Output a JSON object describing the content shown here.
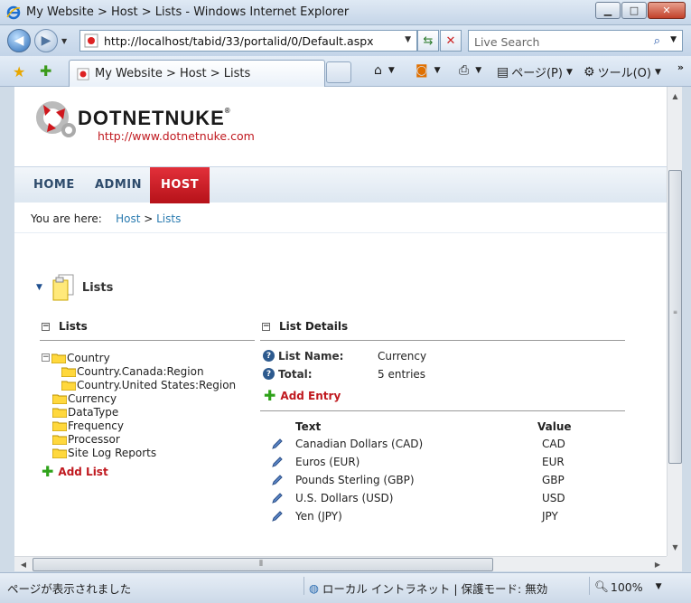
{
  "window": {
    "title": "My Website > Host > Lists - Windows Internet Explorer",
    "minimize": "▁",
    "maximize": "□",
    "close": "✕"
  },
  "address_bar": {
    "url": "http://localhost/tabid/33/portalid/0/Default.aspx",
    "search_placeholder": "Live Search"
  },
  "tab": {
    "label": "My Website > Host > Lists"
  },
  "command_bar": {
    "page_label": "ページ(P)",
    "tools_label": "ツール(O)",
    "more": "»"
  },
  "site": {
    "logo_text": "DOTNETNUKE",
    "logo_reg": "®",
    "logo_url": "http://www.dotnetnuke.com",
    "menu": [
      "HOME",
      "ADMIN",
      "HOST"
    ],
    "active_menu": "HOST",
    "breadcrumb_prefix": "You are here:",
    "breadcrumb_host": "Host",
    "breadcrumb_sep": ">",
    "breadcrumb_lists": "Lists"
  },
  "module": {
    "title": "Lists",
    "lists_section": "Lists",
    "details_section": "List Details",
    "tree": [
      {
        "label": "Country",
        "level": 0,
        "expand": "−"
      },
      {
        "label": "Country.Canada:Region",
        "level": 1
      },
      {
        "label": "Country.United States:Region",
        "level": 1
      },
      {
        "label": "Currency",
        "level": 0
      },
      {
        "label": "DataType",
        "level": 0
      },
      {
        "label": "Frequency",
        "level": 0
      },
      {
        "label": "Processor",
        "level": 0
      },
      {
        "label": "Site Log Reports",
        "level": 0
      }
    ],
    "add_list": "Add List",
    "list_name_label": "List Name:",
    "list_name_value": "Currency",
    "total_label": "Total:",
    "total_value": "5 entries",
    "add_entry": "Add Entry",
    "col_text": "Text",
    "col_value": "Value",
    "entries": [
      {
        "text": "Canadian Dollars (CAD)",
        "value": "CAD"
      },
      {
        "text": "Euros (EUR)",
        "value": "EUR"
      },
      {
        "text": "Pounds Sterling (GBP)",
        "value": "GBP"
      },
      {
        "text": "U.S. Dollars (USD)",
        "value": "USD"
      },
      {
        "text": "Yen (JPY)",
        "value": "JPY"
      }
    ]
  },
  "status_bar": {
    "status": "ページが表示されました",
    "zone": "ローカル イントラネット | 保護モード: 無効",
    "zoom": "100%"
  },
  "colors": {
    "brand_red": "#c0191f",
    "link_blue": "#2a7bb0",
    "menu_text": "#2e4b6b"
  }
}
